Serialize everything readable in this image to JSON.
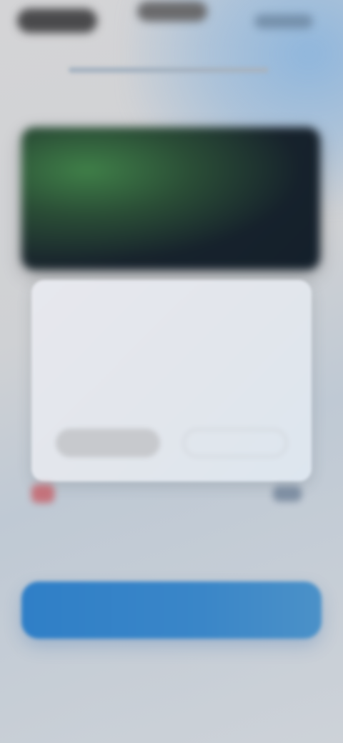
{
  "status_bar": {
    "time": "",
    "carrier": "",
    "battery": ""
  },
  "header": {
    "overline": "",
    "title": ""
  },
  "hero": {
    "icon": "photo-icon"
  },
  "card": {
    "headline": "",
    "body": "",
    "primary_button": "",
    "secondary_button": ""
  },
  "info_row": {
    "text": "",
    "badge_icon": "alert-icon",
    "chip_icon": "toggle-icon"
  },
  "cta": {
    "label": ""
  },
  "colors": {
    "accent": "#2f7fc7",
    "alert": "#c6575f"
  }
}
